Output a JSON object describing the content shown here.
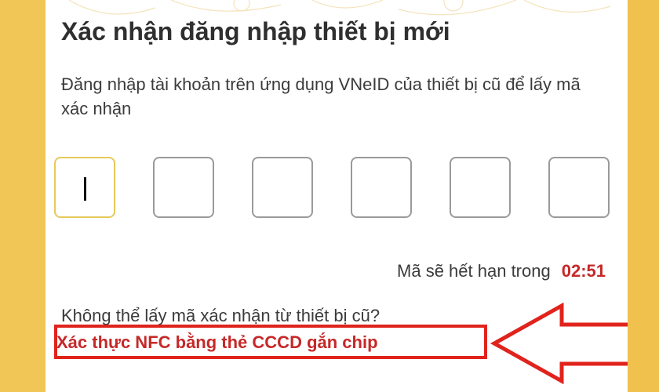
{
  "screen": {
    "title": "Xác nhận đăng nhập thiết bị mới",
    "description": "Đăng nhập tài khoản trên ứng dụng VNeID của thiết bị cũ để lấy mã xác nhận"
  },
  "otp": {
    "digits": [
      "",
      "",
      "",
      "",
      "",
      ""
    ],
    "active_index": 0
  },
  "expiry": {
    "label": "Mã sẽ hết hạn trong",
    "time": "02:51"
  },
  "fallback": {
    "question": "Không thể lấy mã xác nhận từ thiết bị cũ?",
    "link_label": "Xác thực NFC bằng thẻ CCCD gắn chip"
  },
  "colors": {
    "side_frame": "#f0c24b",
    "accent_red": "#c62828",
    "highlight_red": "#e0231c",
    "active_border": "#e6c95a"
  },
  "annotation": {
    "arrow_icon": "left-arrow-outline-icon"
  }
}
